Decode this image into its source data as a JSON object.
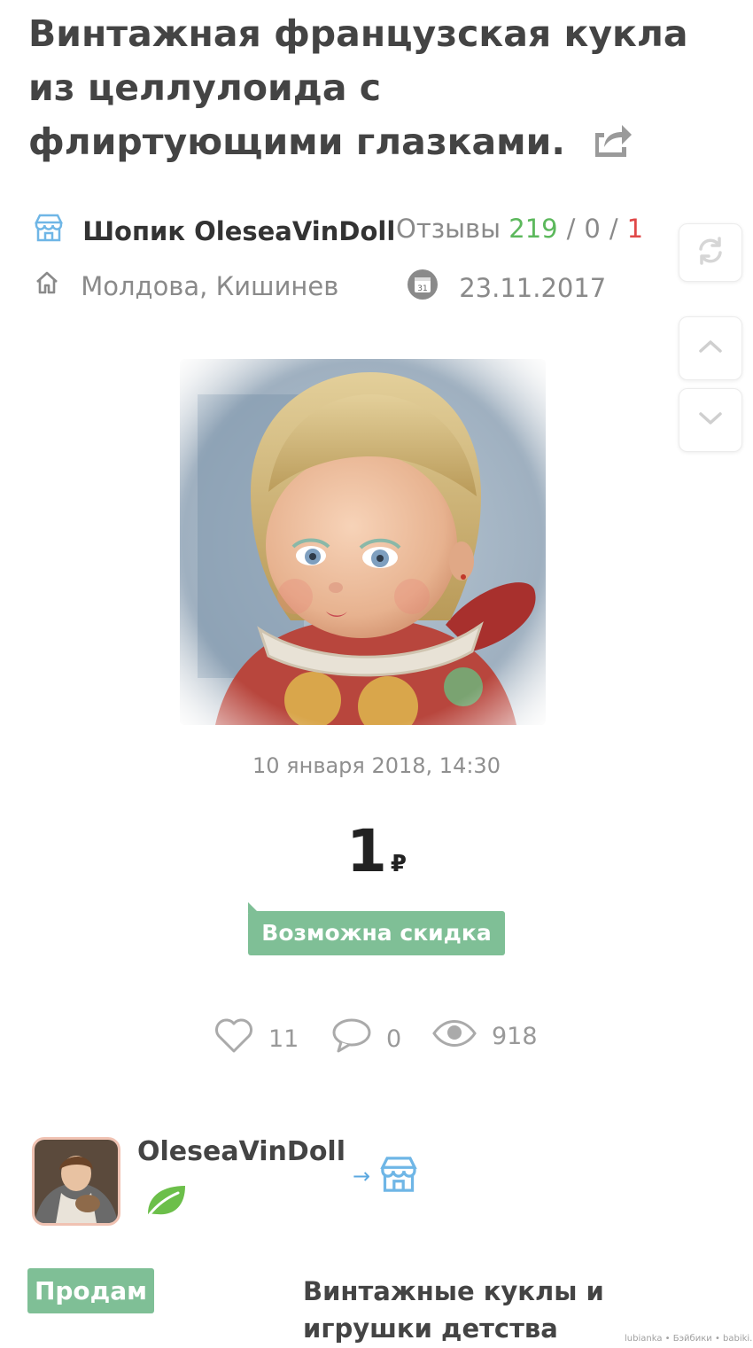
{
  "listing": {
    "title": "Винтажная французская кукла из целлулоида с флиртующими глазками."
  },
  "shop": {
    "label": "Шопик OleseaVinDoll",
    "reviews_label": "Отзывы",
    "reviews_positive": "219",
    "reviews_neutral": "0",
    "reviews_negative": "1",
    "location": "Молдова, Кишинев",
    "since_date": "23.11.2017",
    "calendar_day": "31"
  },
  "post": {
    "published": "10 января 2018, 14:30",
    "price_value": "1",
    "price_currency": "₽",
    "discount_label": "Возможна скидка"
  },
  "stats": {
    "likes": "11",
    "comments": "0",
    "views": "918"
  },
  "seller": {
    "name": "OleseaVinDoll",
    "arrow": "→"
  },
  "footer": {
    "tag": "Продам",
    "category": "Винтажные куклы и игрушки детства",
    "watermark": "lubianka • Бэйбики • babiki.ru"
  },
  "colors": {
    "accent_green": "#7fbf96",
    "positive": "#5cb85c",
    "negative": "#e04848",
    "link_blue": "#5ba8e0"
  },
  "icons": {
    "share": "share-icon",
    "shop": "shop-icon",
    "home": "home-icon",
    "calendar": "calendar-icon",
    "refresh": "refresh-icon",
    "up": "chevron-up-icon",
    "down": "chevron-down-icon",
    "like": "heart-icon",
    "comment": "comment-icon",
    "views": "eye-icon",
    "leaf": "leaf-icon"
  }
}
